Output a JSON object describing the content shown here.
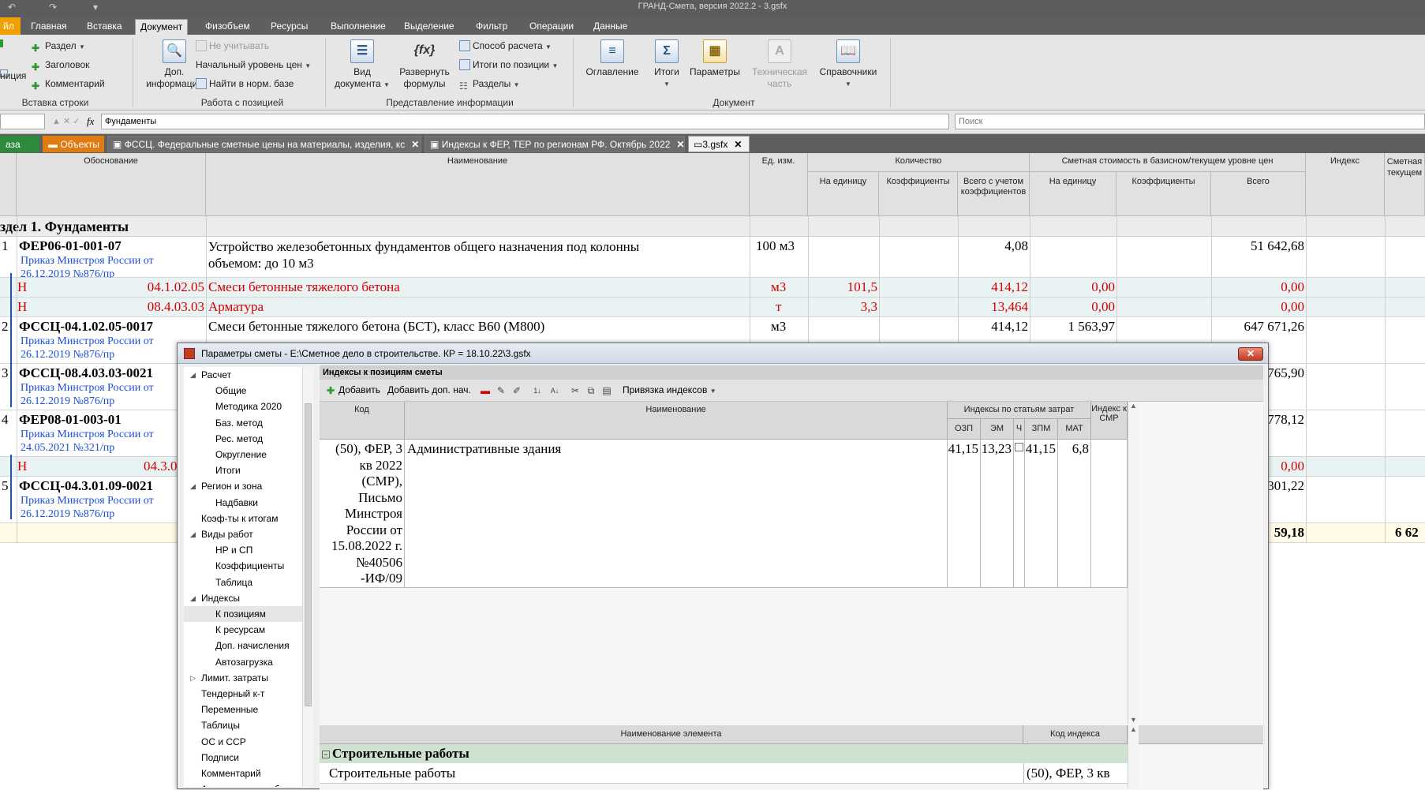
{
  "window": {
    "title": "ГРАНД-Смета, версия 2022.2 - 3.gsfx"
  },
  "ribbon_tabs": [
    "Главная",
    "Вставка",
    "Документ",
    "Физобъем",
    "Ресурсы",
    "Выполнение",
    "Выделение",
    "Фильтр",
    "Операции",
    "Данные"
  ],
  "file_tab": "йл",
  "ribbon": {
    "insert_row": {
      "section": "Раздел",
      "header": "Заголовок",
      "comment": "Комментарий",
      "partial_left": "ниция",
      "label": "Вставка строки"
    },
    "position": {
      "addinfo_line1": "Доп.",
      "addinfo_line2": "информация",
      "ignore": "Не учитывать",
      "start_level": "Начальный уровень цен",
      "find_base": "Найти в норм. базе",
      "label": "Работа с позицией"
    },
    "view": {
      "docview_line1": "Вид",
      "docview_line2": "документа",
      "formulas_line1": "Развернуть",
      "formulas_line2": "формулы",
      "calc_method": "Способ расчета",
      "pos_totals": "Итоги по позиции",
      "sections": "Разделы",
      "label": "Представление информации"
    },
    "document": {
      "toc": "Оглавление",
      "totals": "Итоги",
      "params": "Параметры",
      "tech_line1": "Техническая",
      "tech_line2": "часть",
      "refs": "Справочники",
      "label": "Документ"
    }
  },
  "formula_bar": {
    "value": "Фундаменты",
    "search_placeholder": "Поиск",
    "fx": "fx"
  },
  "doc_tabs": [
    {
      "label": "аза"
    },
    {
      "label": "Объекты"
    },
    {
      "label": "ФССЦ. Федеральные сметные цены на материалы, изделия,  кс"
    },
    {
      "label": "Индексы к ФЕР, ТЕР по регионам РФ. Октябрь 2022"
    },
    {
      "label": "3.gsfx"
    }
  ],
  "grid": {
    "headers": {
      "basis": "Обоснование",
      "name": "Наименование",
      "unit": "Ед. изм.",
      "qty": "Количество",
      "qty_unit": "На единицу",
      "qty_coef": "Коэффициенты",
      "qty_total": "Всего с учетом коэффициентов",
      "cost": "Сметная стоимость в базисном/текущем уровне цен",
      "cost_unit": "На единицу",
      "cost_coef": "Коэффициенты",
      "cost_total": "Всего",
      "index": "Индекс",
      "current_line1": "Сметная",
      "current_line2": "текущем"
    },
    "section_title": "здел 1. Фундаменты",
    "rows": [
      {
        "num": "1",
        "code": "ФЕР06-01-001-07",
        "link1": "Приказ Минстроя России от",
        "link2": "26.12.2019 №876/пр",
        "name1": "Устройство железобетонных фундаментов общего назначения под колонны",
        "name2": "объемом: до 10 м3",
        "unit": "100 м3",
        "qty_total": "4,08",
        "cost_total": "51 642,68"
      },
      {
        "type": "Н",
        "code": "04.1.02.05",
        "name": "Смеси бетонные тяжелого бетона",
        "unit": "м3",
        "qty_unit": "101,5",
        "qty_total": "414,12",
        "cost_unit": "0,00",
        "cost_total": "0,00"
      },
      {
        "type": "Н",
        "code": "08.4.03.03",
        "name": "Арматура",
        "unit": "т",
        "qty_unit": "3,3",
        "qty_total": "13,464",
        "cost_unit": "0,00",
        "cost_total": "0,00"
      },
      {
        "num": "2",
        "code": "ФССЦ-04.1.02.05-0017",
        "name": "Смеси бетонные тяжелого бетона (БСТ), класс В60 (М800)",
        "unit": "м3",
        "qty_total": "414,12",
        "cost_unit": "1 563,97",
        "cost_total": "647 671,26",
        "link1": "Приказ Минстроя России от",
        "link2": "26.12.2019 №876/пр"
      },
      {
        "num": "3",
        "code": "ФССЦ-08.4.03.03-0021",
        "link1": "Приказ Минстроя России от",
        "link2": "26.12.2019 №876/пр",
        "cost_total_partial": "765,90"
      },
      {
        "num": "4",
        "code": "ФЕР08-01-003-01",
        "link1": "Приказ Минстроя России от",
        "link2": "24.05.2021 №321/пр",
        "cost_total_partial": "778,12"
      },
      {
        "type": "Н",
        "code": "04.3.0",
        "cost_total": "0,00"
      },
      {
        "num": "5",
        "code": "ФССЦ-04.3.01.09-0021",
        "link1": "Приказ Минстроя России от",
        "link2": "26.12.2019 №876/пр",
        "cost_total_partial": "301,22"
      }
    ],
    "totals": {
      "cost_total_partial": "59,18",
      "current_partial": "6 62"
    }
  },
  "dialog": {
    "title": "Параметры сметы - E:\\Сметное дело в строительстве. КР = 18.10.22\\3.gsfx",
    "close": "✕",
    "tree": [
      {
        "label": "Расчет",
        "lvl": 0,
        "exp": "open"
      },
      {
        "label": "Общие",
        "lvl": 1
      },
      {
        "label": "Методика 2020",
        "lvl": 1
      },
      {
        "label": "Баз. метод",
        "lvl": 1
      },
      {
        "label": "Рес. метод",
        "lvl": 1
      },
      {
        "label": "Округление",
        "lvl": 1
      },
      {
        "label": "Итоги",
        "lvl": 1
      },
      {
        "label": "Регион и зона",
        "lvl": 0,
        "exp": "open"
      },
      {
        "label": "Надбавки",
        "lvl": 1
      },
      {
        "label": "Коэф-ты к итогам",
        "lvl": 0
      },
      {
        "label": "Виды работ",
        "lvl": 0,
        "exp": "open"
      },
      {
        "label": "НР и СП",
        "lvl": 1
      },
      {
        "label": "Коэффициенты",
        "lvl": 1
      },
      {
        "label": "Таблица",
        "lvl": 1
      },
      {
        "label": "Индексы",
        "lvl": 0,
        "exp": "open"
      },
      {
        "label": "К позициям",
        "lvl": 1,
        "sel": true
      },
      {
        "label": "К ресурсам",
        "lvl": 1
      },
      {
        "label": "Доп. начисления",
        "lvl": 1
      },
      {
        "label": "Автозагрузка",
        "lvl": 1
      },
      {
        "label": "Лимит. затраты",
        "lvl": 0,
        "exp": "closed"
      },
      {
        "label": "Тендерный к-т",
        "lvl": 0
      },
      {
        "label": "Переменные",
        "lvl": 0
      },
      {
        "label": "Таблицы",
        "lvl": 0
      },
      {
        "label": "ОС и ССР",
        "lvl": 0
      },
      {
        "label": "Подписи",
        "lvl": 0
      },
      {
        "label": "Комментарий",
        "lvl": 0
      },
      {
        "label": "Акты выполн. работ",
        "lvl": 0
      }
    ],
    "pane_title": "Индексы к позициям сметы",
    "toolbar": {
      "add": "Добавить",
      "add_extra": "Добавить доп. нач.",
      "bind": "Привязка индексов"
    },
    "table": {
      "h_code": "Код",
      "h_name": "Наименование",
      "h_group": "Индексы по статьям затрат",
      "h_smr_line1": "Индекс к",
      "h_smr_line2": "СМР",
      "h_ozp": "ОЗП",
      "h_em": "ЭМ",
      "h_ch": "Ч",
      "h_zpm": "ЗПМ",
      "h_mat": "МАТ",
      "row": {
        "code_lines": [
          "(50), ФЕР, 3",
          "кв 2022",
          "(СМР),",
          "Письмо",
          "Минстроя",
          "России от",
          "15.08.2022 г.",
          "№40506",
          "-ИФ/09"
        ],
        "name": "Административные здания",
        "ozp": "41,15",
        "em": "13,23",
        "zpm": "41,15",
        "mat": "6,8"
      }
    },
    "lower": {
      "h_elem": "Наименование элемента",
      "h_code": "Код индекса",
      "group": "Строительные работы",
      "row_name": "Строительные работы",
      "row_code": "(50), ФЕР, 3 кв"
    }
  }
}
